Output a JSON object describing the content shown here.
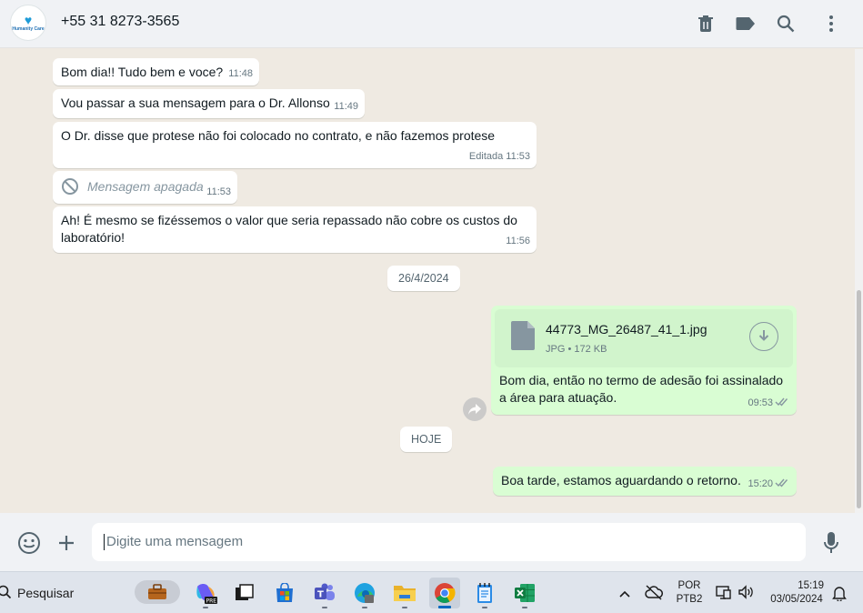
{
  "header": {
    "avatar_text": "Humanity Care",
    "contact": "+55 31 8273-3565",
    "icons": [
      "delete-icon",
      "label-icon",
      "search-icon",
      "menu-icon"
    ]
  },
  "messages": [
    {
      "text": "Bom dia!! Tudo bem e voce?",
      "time": "11:48"
    },
    {
      "text": "Vou passar a sua mensagem para o Dr. Allonso",
      "time": "11:49"
    },
    {
      "text": "O Dr. disse que protese não foi colocado no contrato, e não fazemos protese",
      "time": "Editada 11:53"
    },
    {
      "text": "Mensagem apagada",
      "time": "11:53"
    },
    {
      "text": "Ah! É mesmo se fizéssemos o valor que seria repassado não cobre os custos do laboratório!",
      "time": "11:56"
    }
  ],
  "date_1": "26/4/2024",
  "file_message": {
    "file_name": "44773_MG_26487_41_1.jpg",
    "file_meta": "JPG • 172 KB",
    "caption": "Bom dia, então no termo de adesão foi assinalado a área para atuação.",
    "time": "09:53"
  },
  "date_2": "HOJE",
  "last_message": {
    "text": "Boa tarde, estamos aguardando o retorno.",
    "time": "15:20"
  },
  "composer": {
    "placeholder": "Digite uma mensagem"
  },
  "taskbar": {
    "search_label": "Pesquisar",
    "lang_1": "POR",
    "lang_2": "PTB2",
    "clock_time": "15:19",
    "clock_date": "03/05/2024"
  },
  "colors": {
    "outgoing": "#d9fdd3",
    "incoming": "#ffffff",
    "background": "#efeae2",
    "tick": "#8696a0"
  }
}
